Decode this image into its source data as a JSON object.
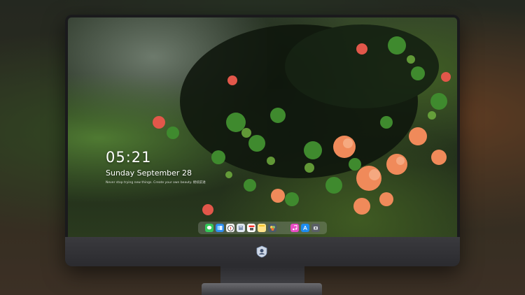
{
  "lockscreen": {
    "time": "05:21",
    "date": "Sunday September  28",
    "quote": "Never stop trying new things. Create your own beauty. 继续前进"
  },
  "dock": {
    "icons": [
      "messages-icon",
      "finder-icon",
      "safari-icon",
      "files-icon",
      "calendar-icon",
      "notes-icon",
      "photos-icon",
      "music-icon",
      "app-store-icon",
      "screenshot-icon"
    ]
  },
  "colors": {
    "leaf_red": "#e2574a",
    "leaf_orange": "#f08a5a",
    "leaf_green": "#3f8a2e",
    "bezel": "#1a1a1c"
  }
}
